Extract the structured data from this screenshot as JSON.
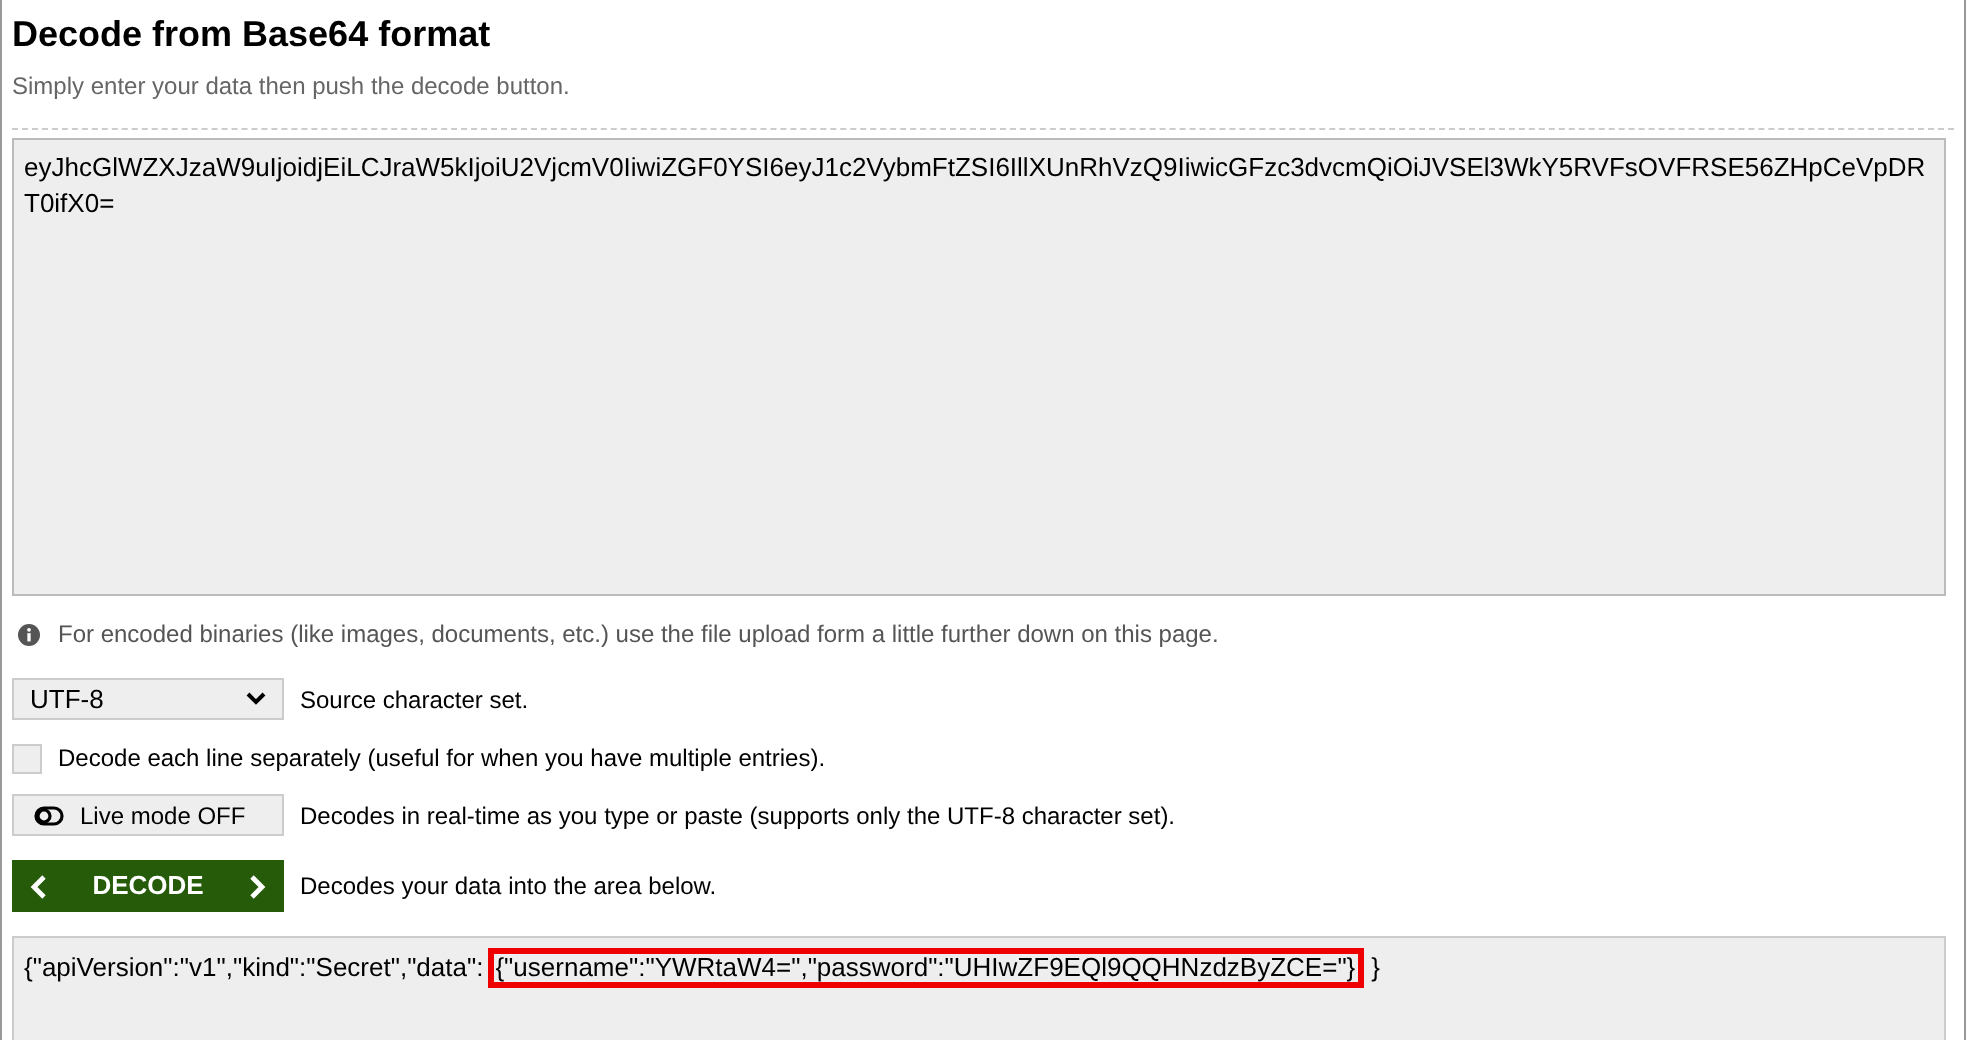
{
  "title": "Decode from Base64 format",
  "subtitle": "Simply enter your data then push the decode button.",
  "input": {
    "value": "eyJhcGlWZXJzaW9uIjoidjEiLCJraW5kIjoiU2VjcmV0IiwiZGF0YSI6eyJ1c2VybmFtZSI6IllXUnRhVzQ9IiwicGFzc3dvcmQiOiJVSEl3WkY5RVFsOVFRSE56ZHpCeVpDRT0ifX0="
  },
  "info": "For encoded binaries (like images, documents, etc.) use the file upload form a little further down on this page.",
  "charset": {
    "value": "UTF-8",
    "label": "Source character set."
  },
  "separate_lines": {
    "checked": false,
    "label": "Decode each line separately (useful for when you have multiple entries)."
  },
  "live_mode": {
    "on": false,
    "button": "Live mode OFF",
    "label": "Decodes in real-time as you type or paste (supports only the UTF-8 character set)."
  },
  "decode": {
    "button": "DECODE",
    "label": "Decodes your data into the area below."
  },
  "output": {
    "text_before": "{\"apiVersion\":\"v1\",\"kind\":\"Secret\",\"data\":",
    "highlighted_text": "{\"username\":\"YWRtaW4=\",\"password\":\"UHIwZF9EQl9QQHNzdzByZCE=\"}",
    "text_after": "}"
  }
}
